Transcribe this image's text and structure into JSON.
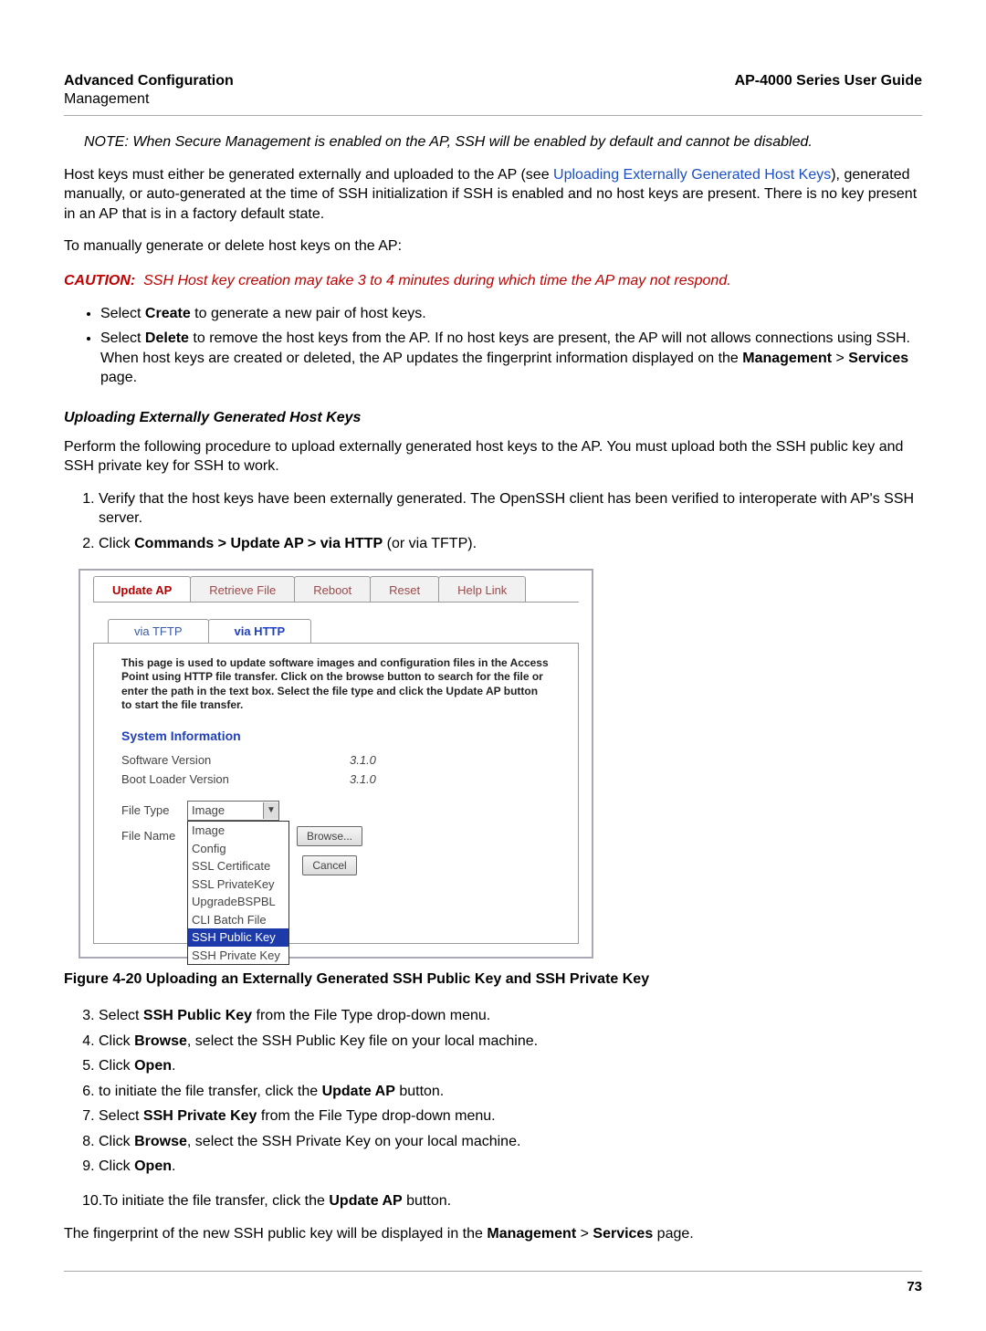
{
  "header": {
    "left_title": "Advanced Configuration",
    "left_sub": "Management",
    "right_title": "AP-4000 Series User Guide"
  },
  "note": {
    "label": "NOTE:",
    "text": "When Secure Management is enabled on the AP, SSH will be enabled by default and cannot be disabled."
  },
  "para1": {
    "a": "Host keys must either be generated externally and uploaded to the AP (see ",
    "link": "Uploading Externally Generated Host Keys",
    "b": "), generated manually, or auto-generated at the time of SSH initialization if SSH is enabled and no host keys are present. There is no key present in an AP that is in a factory default state."
  },
  "para2": "To manually generate or delete host keys on the AP:",
  "caution": {
    "label": "CAUTION:",
    "text": "SSH Host key creation may take 3 to 4 minutes during which time the AP may not respond."
  },
  "bullets": {
    "b1a": "Select ",
    "b1b": "Create",
    "b1c": " to generate a new pair of host keys.",
    "b2a": "Select ",
    "b2b": "Delete",
    "b2c": " to remove the host keys from the AP. If no host keys are present, the AP will not allows connections using SSH. When host keys are created or deleted, the AP updates the fingerprint information displayed on the ",
    "b2d": "Management",
    "b2e": " > ",
    "b2f": "Services",
    "b2g": " page."
  },
  "subhead": "Uploading Externally Generated Host Keys",
  "para3": "Perform the following procedure to upload externally generated host keys to the AP. You must upload both the SSH public key and SSH private key for SSH to work.",
  "steps12": {
    "s1": "Verify that the host keys have been externally generated. The OpenSSH client has been verified to interoperate with AP's SSH server.",
    "s2a": "Click ",
    "s2b": "Commands > Update AP > via HTTP",
    "s2c": " (or via TFTP)."
  },
  "shot": {
    "tabs": [
      "Update AP",
      "Retrieve File",
      "Reboot",
      "Reset",
      "Help Link"
    ],
    "subtabs": [
      "via TFTP",
      "via HTTP"
    ],
    "desc": "This page is used to update software images and configuration files in the Access Point using HTTP file transfer. Click on the browse button to search for the file or enter the path in the text box. Select the file type and click the Update AP button to start the file transfer.",
    "sysinfo_title": "System Information",
    "sw_label": "Software Version",
    "sw_val": "3.1.0",
    "bl_label": "Boot Loader Version",
    "bl_val": "3.1.0",
    "filetype_label": "File Type",
    "filename_label": "File Name",
    "select_value": "Image",
    "dropdown": [
      "Image",
      "Config",
      "SSL Certificate",
      "SSL PrivateKey",
      "UpgradeBSPBL",
      "CLI Batch File",
      "SSH Public Key",
      "SSH Private Key"
    ],
    "dropdown_selected_index": 6,
    "browse_btn": "Browse...",
    "cancel_btn": "Cancel"
  },
  "figcaption": "Figure 4-20 Uploading an Externally Generated SSH Public Key and SSH Private Key",
  "steps3plus": {
    "s3a": "Select ",
    "s3b": "SSH Public Key",
    "s3c": " from the File Type drop-down menu.",
    "s4a": "Click ",
    "s4b": "Browse",
    "s4c": ", select the SSH Public Key file on your local machine.",
    "s5a": "Click ",
    "s5b": "Open",
    "s5c": ".",
    "s6a": "to initiate the file transfer, click the ",
    "s6b": "Update AP",
    "s6c": " button.",
    "s7a": "Select ",
    "s7b": "SSH Private Key",
    "s7c": " from the File Type drop-down menu.",
    "s8a": "Click ",
    "s8b": "Browse",
    "s8c": ", select the SSH Private Key on your local machine.",
    "s9a": "Click ",
    "s9b": "Open",
    "s9c": ".",
    "s10a": "To initiate the file transfer, click the ",
    "s10b": "Update AP",
    "s10c": " button."
  },
  "para4": {
    "a": "The fingerprint of the new SSH public key will be displayed in the ",
    "b": "Management",
    "c": " > ",
    "d": "Services",
    "e": " page."
  },
  "page_number": "73"
}
